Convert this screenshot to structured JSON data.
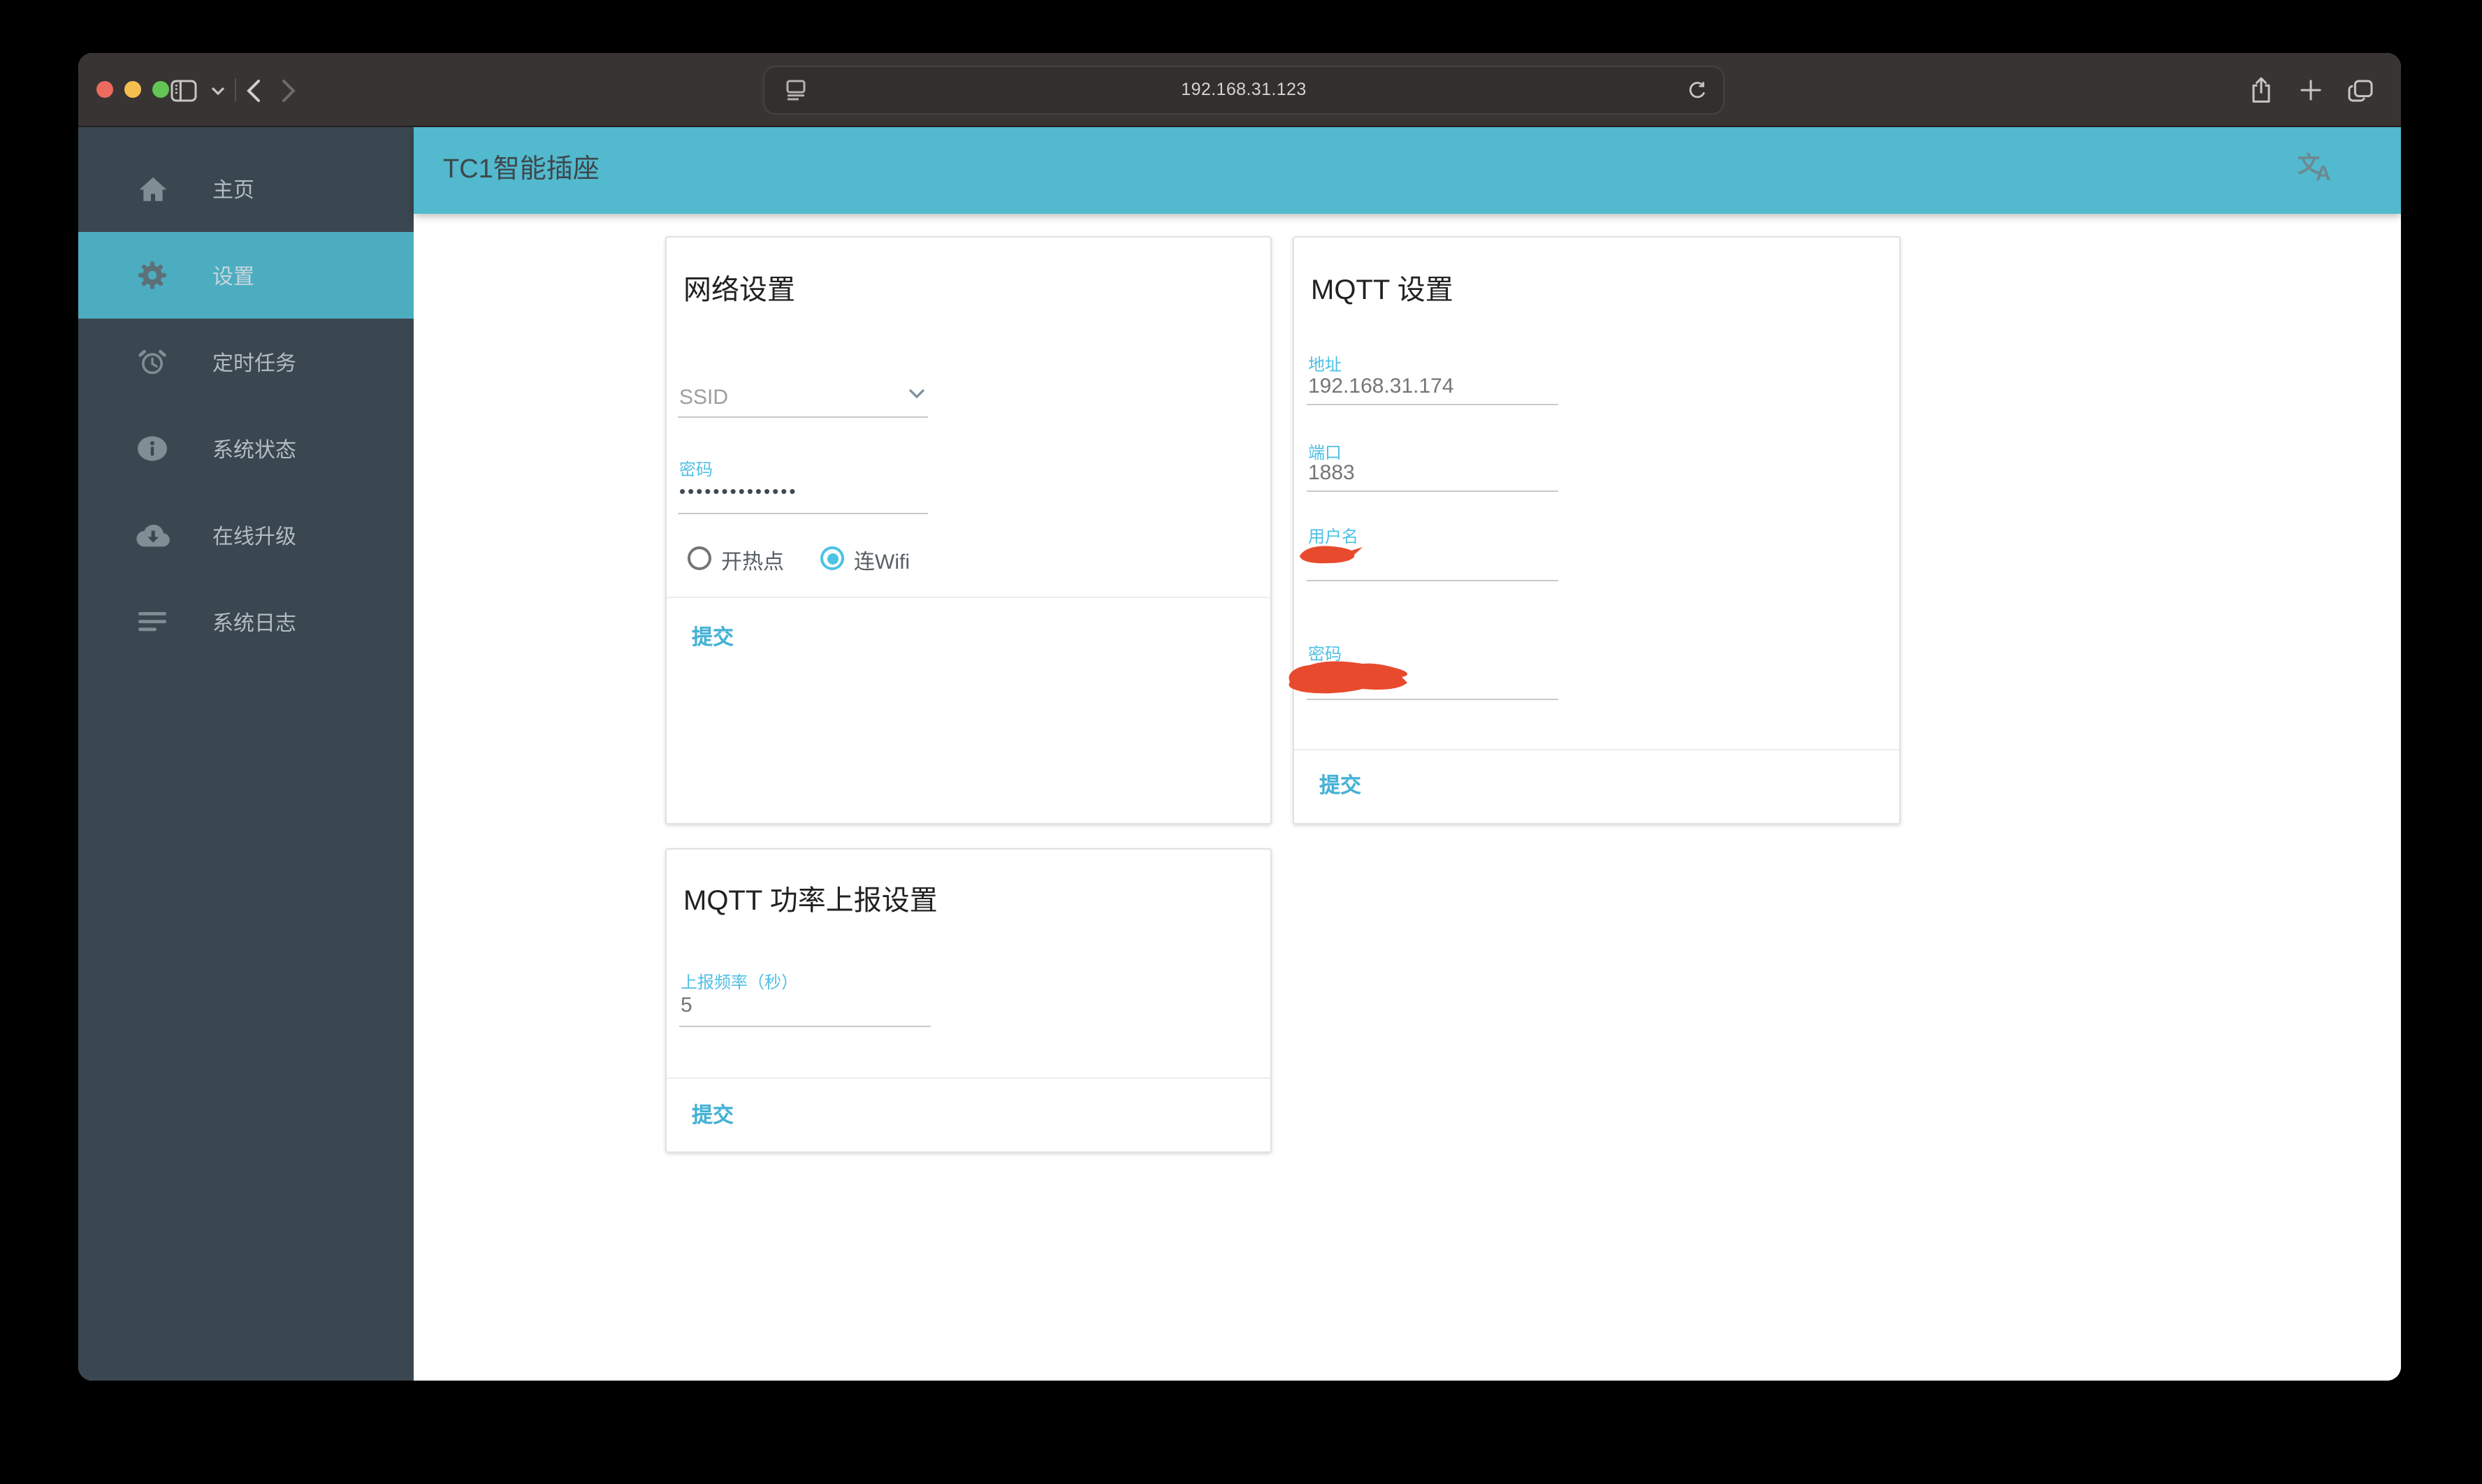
{
  "browser": {
    "url": "192.168.31.123",
    "traffic_lights": [
      "close",
      "minimize",
      "fullscreen"
    ]
  },
  "page_header": {
    "title": "TC1智能插座",
    "translate_icon_zh": "文",
    "translate_icon_en": "A"
  },
  "sidebar": {
    "items": [
      {
        "label": "主页",
        "icon": "home-icon",
        "active": false
      },
      {
        "label": "设置",
        "icon": "gear-icon",
        "active": true
      },
      {
        "label": "定时任务",
        "icon": "alarm-clock-icon",
        "active": false
      },
      {
        "label": "系统状态",
        "icon": "info-icon",
        "active": false
      },
      {
        "label": "在线升级",
        "icon": "cloud-download-icon",
        "active": false
      },
      {
        "label": "系统日志",
        "icon": "log-lines-icon",
        "active": false
      }
    ]
  },
  "cards": {
    "network": {
      "title": "网络设置",
      "ssid_placeholder": "SSID",
      "password_label": "密码",
      "password_value": "••••••••••••••",
      "radios": [
        {
          "label": "开热点",
          "selected": false
        },
        {
          "label": "连Wifi",
          "selected": true
        }
      ],
      "submit_label": "提交"
    },
    "mqtt": {
      "title": "MQTT 设置",
      "address_label": "地址",
      "address_value": "192.168.31.174",
      "port_label": "端口",
      "port_value": "1883",
      "username_label": "用户名",
      "username_value_redacted": true,
      "password_label": "密码",
      "password_value_redacted": true,
      "submit_label": "提交"
    },
    "power_report": {
      "title": "MQTT 功率上报设置",
      "frequency_label": "上报频率（秒）",
      "frequency_value": "5",
      "submit_label": "提交"
    }
  },
  "colors": {
    "header_teal": "#52b9ce",
    "sidebar_bg": "#3a4750",
    "sidebar_selected": "#4cadc1",
    "field_label_blue": "#4fbfe4",
    "submit_teal": "#46b2d5",
    "radio_selected": "#4cc2e4",
    "redaction_red": "#e84a2d",
    "toolbar_bg": "#383433"
  }
}
